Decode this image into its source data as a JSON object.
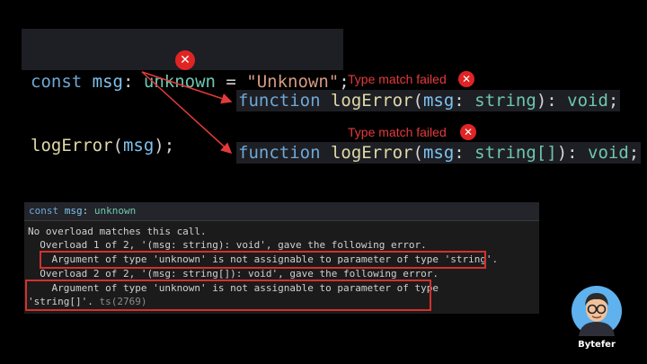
{
  "code_top": {
    "line1": {
      "kw": "const",
      "var": "msg",
      "colon": ":",
      "type": "unknown",
      "eq": " = ",
      "str": "\"Unknown\"",
      "semi": ";"
    },
    "line2": {
      "fn": "logError",
      "open": "(",
      "arg": "msg",
      "close": ");"
    }
  },
  "signatures": [
    {
      "kw": "function",
      "fn": "logError",
      "open": "(",
      "param": "msg",
      "colon": ":",
      "type": "string",
      "close": "): ",
      "ret": "void",
      "semi": ";"
    },
    {
      "kw": "function",
      "fn": "logError",
      "open": "(",
      "param": "msg",
      "colon": ":",
      "type": "string[]",
      "close": "): ",
      "ret": "void",
      "semi": ";"
    }
  ],
  "fail_label": "Type match failed",
  "error_mark": "✕",
  "panel": {
    "header_kw": "const",
    "header_var": "msg",
    "header_colon": ":",
    "header_type": "unknown",
    "lines": [
      "No overload matches this call.",
      "  Overload 1 of 2, '(msg: string): void', gave the following error.",
      "    Argument of type 'unknown' is not assignable to parameter of type 'string'.",
      "  Overload 2 of 2, '(msg: string[]): void', gave the following error.",
      "    Argument of type 'unknown' is not assignable to parameter of type",
      "'string[]'."
    ],
    "error_code": " ts(2769)"
  },
  "brand": "Bytefer",
  "colors": {
    "keyword": "#6ea8d6",
    "type": "#6fc7b0",
    "error": "#e02424"
  }
}
